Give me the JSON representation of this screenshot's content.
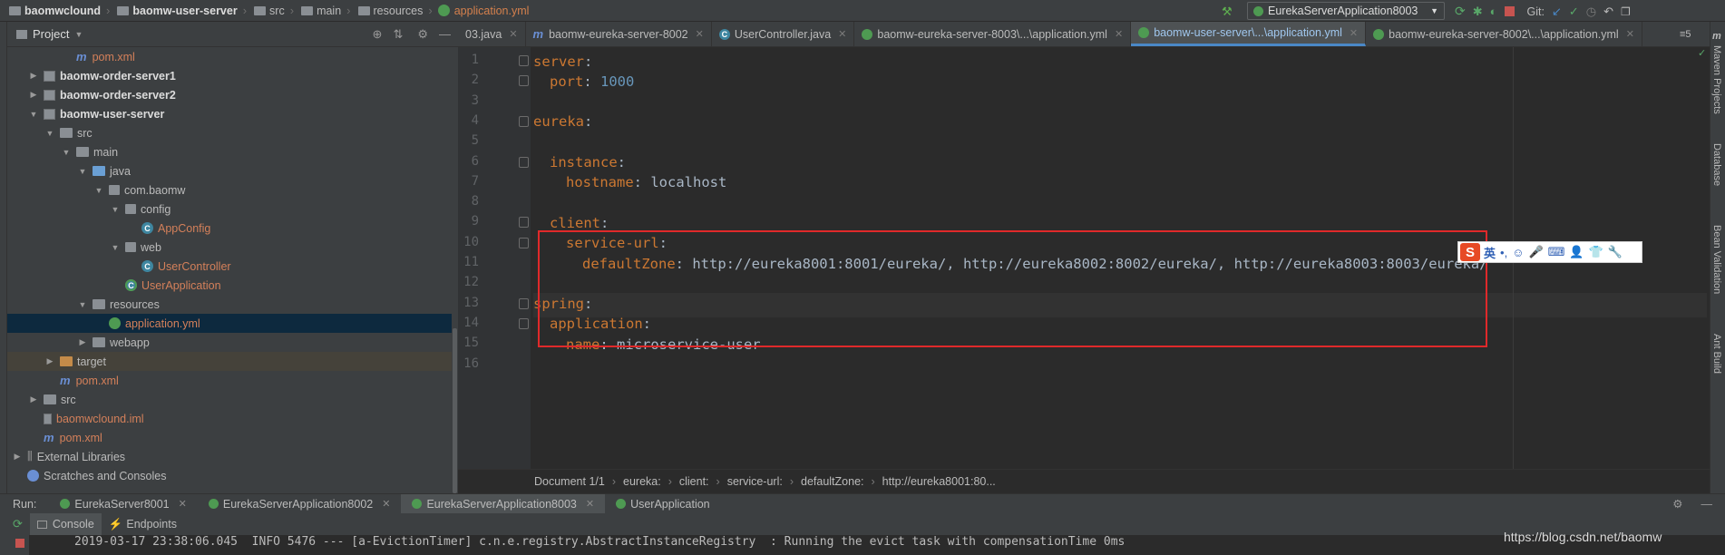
{
  "breadcrumb": [
    "baomwclound",
    "baomw-user-server",
    "src",
    "main",
    "resources",
    "application.yml"
  ],
  "toolbar": {
    "run_config": "EurekaServerApplication8003",
    "git_label": "Git:"
  },
  "project_panel": {
    "title": "Project"
  },
  "tree": [
    {
      "label": "pom.xml",
      "icon": "m-icon",
      "depth": 3
    },
    {
      "label": "baomw-order-server1",
      "icon": "module-folder-icon",
      "depth": 1,
      "arrow": "right"
    },
    {
      "label": "baomw-order-server2",
      "icon": "module-folder-icon",
      "depth": 1,
      "arrow": "right"
    },
    {
      "label": "baomw-user-server",
      "icon": "module-folder-icon",
      "depth": 1,
      "arrow": "down"
    },
    {
      "label": "src",
      "icon": "folder-icon",
      "depth": 2,
      "arrow": "down"
    },
    {
      "label": "main",
      "icon": "folder-icon",
      "depth": 3,
      "arrow": "down"
    },
    {
      "label": "java",
      "icon": "folder-icon",
      "depth": 4,
      "arrow": "down"
    },
    {
      "label": "com.baomw",
      "icon": "package-icon",
      "depth": 5,
      "arrow": "down"
    },
    {
      "label": "config",
      "icon": "package-icon",
      "depth": 6,
      "arrow": "down"
    },
    {
      "label": "AppConfig",
      "icon": "class-icon",
      "depth": 7
    },
    {
      "label": "web",
      "icon": "package-icon",
      "depth": 6,
      "arrow": "down"
    },
    {
      "label": "UserController",
      "icon": "class-icon",
      "depth": 7
    },
    {
      "label": "UserApplication",
      "icon": "spring-class-icon",
      "depth": 6
    },
    {
      "label": "resources",
      "icon": "folder-icon",
      "depth": 4,
      "arrow": "down"
    },
    {
      "label": "application.yml",
      "icon": "yml-icon",
      "depth": 5
    },
    {
      "label": "webapp",
      "icon": "folder-icon",
      "depth": 4,
      "arrow": "right"
    },
    {
      "label": "target",
      "icon": "target-folder-icon",
      "depth": 2,
      "arrow": "right"
    },
    {
      "label": "pom.xml",
      "icon": "m-icon",
      "depth": 2
    },
    {
      "label": "src",
      "icon": "folder-icon",
      "depth": 1,
      "arrow": "right"
    },
    {
      "label": "baomwclound.iml",
      "icon": "iml-icon",
      "depth": 1
    },
    {
      "label": "pom.xml",
      "icon": "m-icon",
      "depth": 1
    },
    {
      "label": "External Libraries",
      "icon": "library-icon",
      "depth": 0,
      "arrow": "right"
    },
    {
      "label": "Scratches and Consoles",
      "icon": "scratch-icon",
      "depth": 0
    }
  ],
  "tabs": [
    {
      "label": "03.java",
      "icon": "none"
    },
    {
      "label": "baomw-eureka-server-8002",
      "icon": "m-icon"
    },
    {
      "label": "UserController.java",
      "icon": "class-icon"
    },
    {
      "label": "baomw-eureka-server-8003\\...\\application.yml",
      "icon": "yml-icon"
    },
    {
      "label": "baomw-user-server\\...\\application.yml",
      "icon": "yml-icon",
      "active": true
    },
    {
      "label": "baomw-eureka-server-8002\\...\\application.yml",
      "icon": "yml-icon"
    }
  ],
  "tabs_overflow": "≡5",
  "code_lines": [
    {
      "num": "1",
      "key": "server",
      "value": ""
    },
    {
      "num": "2",
      "key": "port",
      "value": "1000",
      "indent": 1,
      "numeric": true
    },
    {
      "num": "3",
      "key": "",
      "value": ""
    },
    {
      "num": "4",
      "key": "eureka",
      "value": ""
    },
    {
      "num": "5",
      "key": "",
      "value": ""
    },
    {
      "num": "6",
      "key": "instance",
      "value": "",
      "indent": 1
    },
    {
      "num": "7",
      "key": "hostname",
      "value": "localhost",
      "indent": 2
    },
    {
      "num": "8",
      "key": "",
      "value": ""
    },
    {
      "num": "9",
      "key": "client",
      "value": "",
      "indent": 1
    },
    {
      "num": "10",
      "key": "service-url",
      "value": "",
      "indent": 2
    },
    {
      "num": "11",
      "key": "defaultZone",
      "value": "http://eureka8001:8001/eureka/, http://eureka8002:8002/eureka/, http://eureka8003:8003/eureka/",
      "indent": 3
    },
    {
      "num": "12",
      "key": "",
      "value": ""
    },
    {
      "num": "13",
      "key": "spring",
      "value": ""
    },
    {
      "num": "14",
      "key": "application",
      "value": "",
      "indent": 1
    },
    {
      "num": "15",
      "key": "name",
      "value": "microservice-user",
      "indent": 2
    },
    {
      "num": "16",
      "key": "",
      "value": ""
    }
  ],
  "ime_label": "英",
  "status_breadcrumb": [
    "Document 1/1",
    "eureka:",
    "client:",
    "service-url:",
    "defaultZone:",
    "http://eureka8001:80..."
  ],
  "right_tools": [
    "Maven Projects",
    "Database",
    "Bean Validation",
    "Ant Build"
  ],
  "run_panel": {
    "label": "Run:",
    "tabs": [
      {
        "label": "EurekaServer8001"
      },
      {
        "label": "EurekaServerApplication8002"
      },
      {
        "label": "EurekaServerApplication8003",
        "active": true
      },
      {
        "label": "UserApplication"
      }
    ],
    "sub_tabs": [
      "Console",
      "Endpoints"
    ],
    "console_line": "2019-03-17 23:38:06.045  INFO 5476 --- [a-EvictionTimer] c.n.e.registry.AbstractInstanceRegistry  : Running the evict task with compensationTime 0ms"
  },
  "watermark": "https://blog.csdn.net/baomw",
  "colors": {
    "keyword": "#cc7832",
    "number": "#6897bb",
    "text": "#a9b7c6",
    "highlight_box": "#e0292a",
    "active_tab_underline": "#4a88c7"
  }
}
